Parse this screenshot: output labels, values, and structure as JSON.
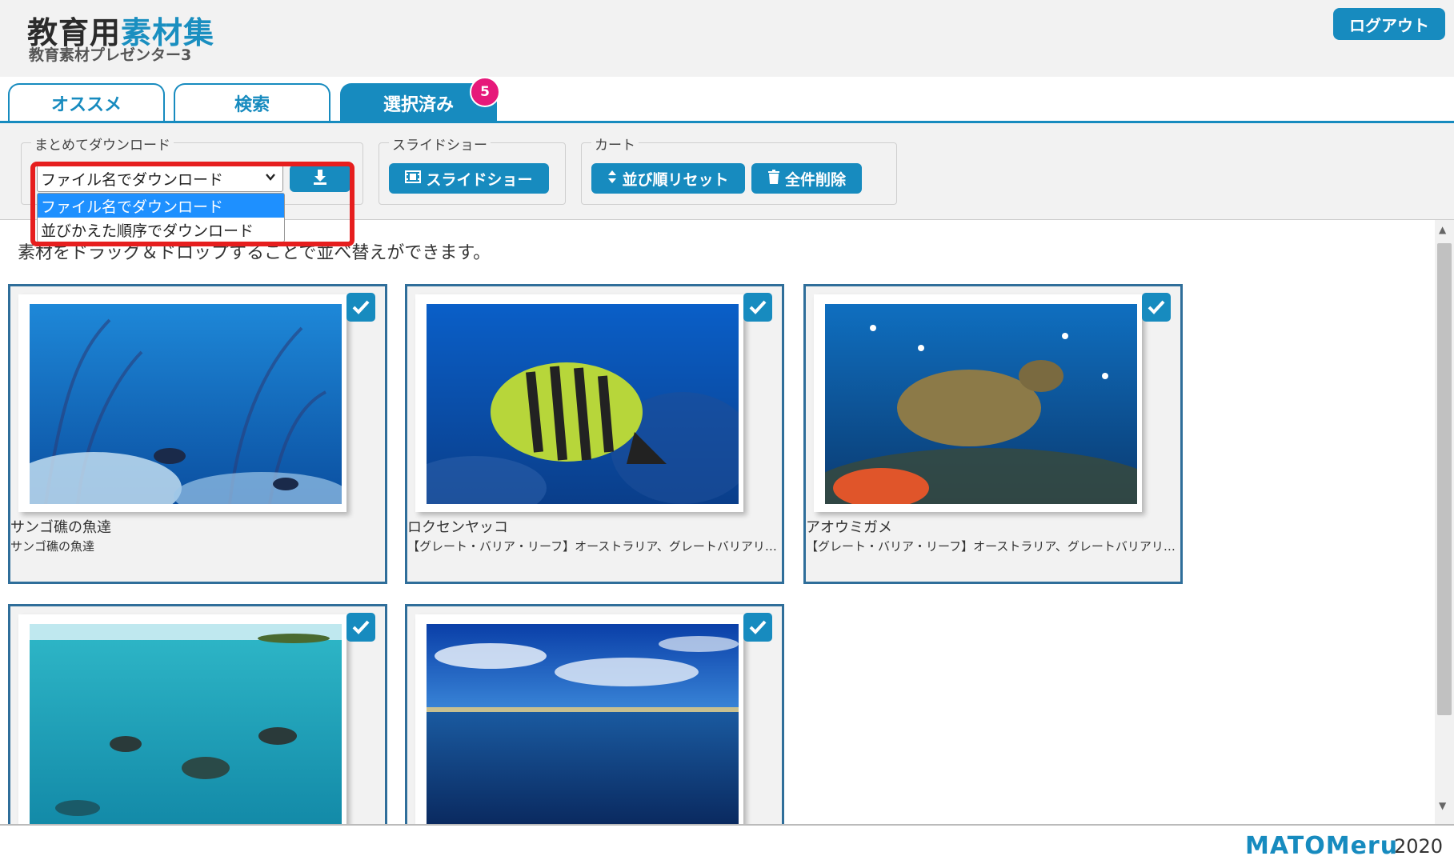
{
  "header": {
    "title_part1": "教育用",
    "title_part2": "素材集",
    "subtitle": "教育素材プレゼンター3",
    "logout_label": "ログアウト"
  },
  "tabs": [
    {
      "label": "オススメ",
      "active": false
    },
    {
      "label": "検索",
      "active": false
    },
    {
      "label": "選択済み",
      "active": true,
      "badge": "5"
    }
  ],
  "toolbar": {
    "download_group": {
      "legend": "まとめてダウンロード",
      "select_value": "ファイル名でダウンロード",
      "options": [
        "ファイル名でダウンロード",
        "並びかえた順序でダウンロード"
      ],
      "download_icon": "download-icon"
    },
    "slideshow_group": {
      "legend": "スライドショー",
      "button_label": "スライドショー"
    },
    "cart_group": {
      "legend": "カート",
      "reset_label": "並び順リセット",
      "delete_label": "全件削除"
    }
  },
  "main": {
    "hint": "素材をドラッグ＆ドロップすることで並べ替えができます。",
    "items": [
      {
        "title": "サンゴ礁の魚達",
        "desc": "サンゴ礁の魚達",
        "checked": true
      },
      {
        "title": "ロクセンヤッコ",
        "desc": "【グレート・バリア・リーフ】オーストラリア、グレートバリアリーフ",
        "checked": true
      },
      {
        "title": "アオウミガメ",
        "desc": "【グレート・バリア・リーフ】オーストラリア、グレートバリアリーフ",
        "checked": true
      },
      {
        "title": "",
        "desc": "",
        "checked": true
      },
      {
        "title": "",
        "desc": "",
        "checked": true
      }
    ]
  },
  "footer": {
    "brand": "MATOMeru",
    "year": "2020"
  },
  "colors": {
    "accent": "#178bbf",
    "badge": "#e6197a",
    "highlight": "#e61e1e"
  }
}
